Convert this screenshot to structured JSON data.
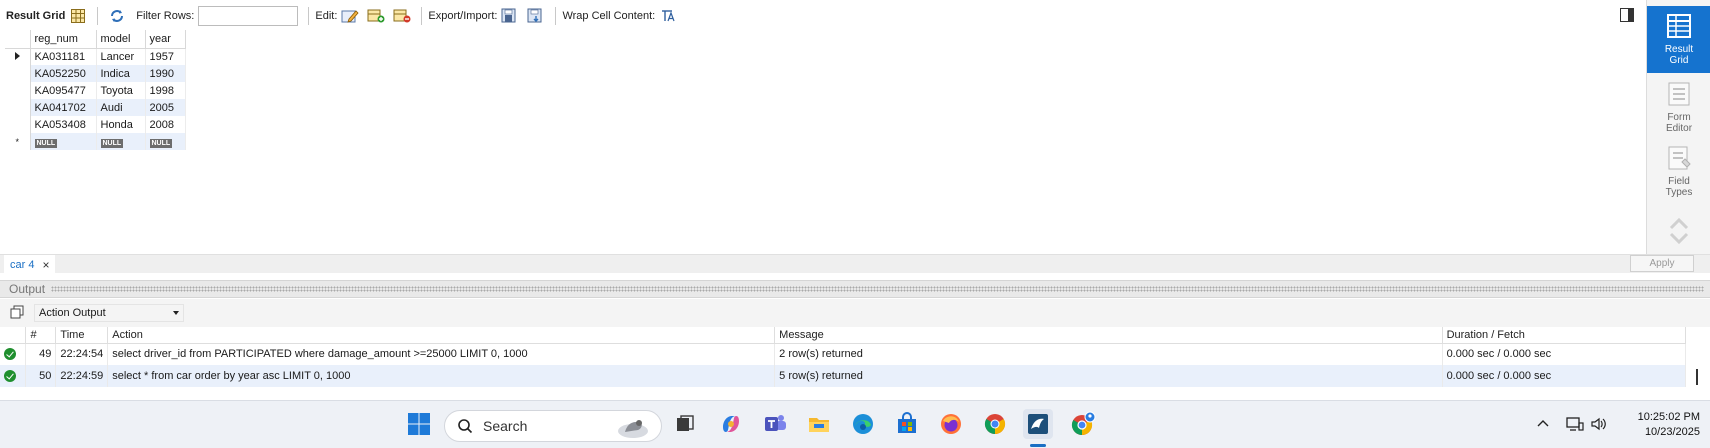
{
  "toolbar": {
    "result_grid_label": "Result Grid",
    "filter_rows_label": "Filter Rows:",
    "filter_value": "",
    "edit_label": "Edit:",
    "export_import_label": "Export/Import:",
    "wrap_cell_label": "Wrap Cell Content:"
  },
  "grid": {
    "columns": [
      "reg_num",
      "model",
      "year"
    ],
    "rows": [
      [
        "KA031181",
        "Lancer",
        "1957"
      ],
      [
        "KA052250",
        "Indica",
        "1990"
      ],
      [
        "KA095477",
        "Toyota",
        "1998"
      ],
      [
        "KA041702",
        "Audi",
        "2005"
      ],
      [
        "KA053408",
        "Honda",
        "2008"
      ]
    ],
    "null_label": "NULL",
    "new_row_marker": "*"
  },
  "side_panel": {
    "result_grid": [
      "Result",
      "Grid"
    ],
    "form_editor": [
      "Form",
      "Editor"
    ],
    "field_types": [
      "Field",
      "Types"
    ],
    "apply": "Apply"
  },
  "tab": {
    "label": "car 4",
    "close": "×"
  },
  "output": {
    "title": "Output",
    "mode": "Action Output",
    "columns": [
      "#",
      "Time",
      "Action",
      "Message",
      "Duration / Fetch"
    ],
    "rows": [
      {
        "num": "49",
        "time": "22:24:54",
        "action": "select driver_id from PARTICIPATED where damage_amount >=25000 LIMIT 0, 1000",
        "message": "2 row(s) returned",
        "duration": "0.000 sec / 0.000 sec"
      },
      {
        "num": "50",
        "time": "22:24:59",
        "action": "select * from car order by year asc LIMIT 0, 1000",
        "message": "5 row(s) returned",
        "duration": "0.000 sec / 0.000 sec"
      }
    ]
  },
  "taskbar": {
    "search_placeholder": "Search",
    "time": "10:25:02 PM",
    "date": "10/23/2025"
  },
  "colors": {
    "accent": "#1573cf",
    "selected_row": "#e9f0fb",
    "success": "#1f8f2e"
  }
}
